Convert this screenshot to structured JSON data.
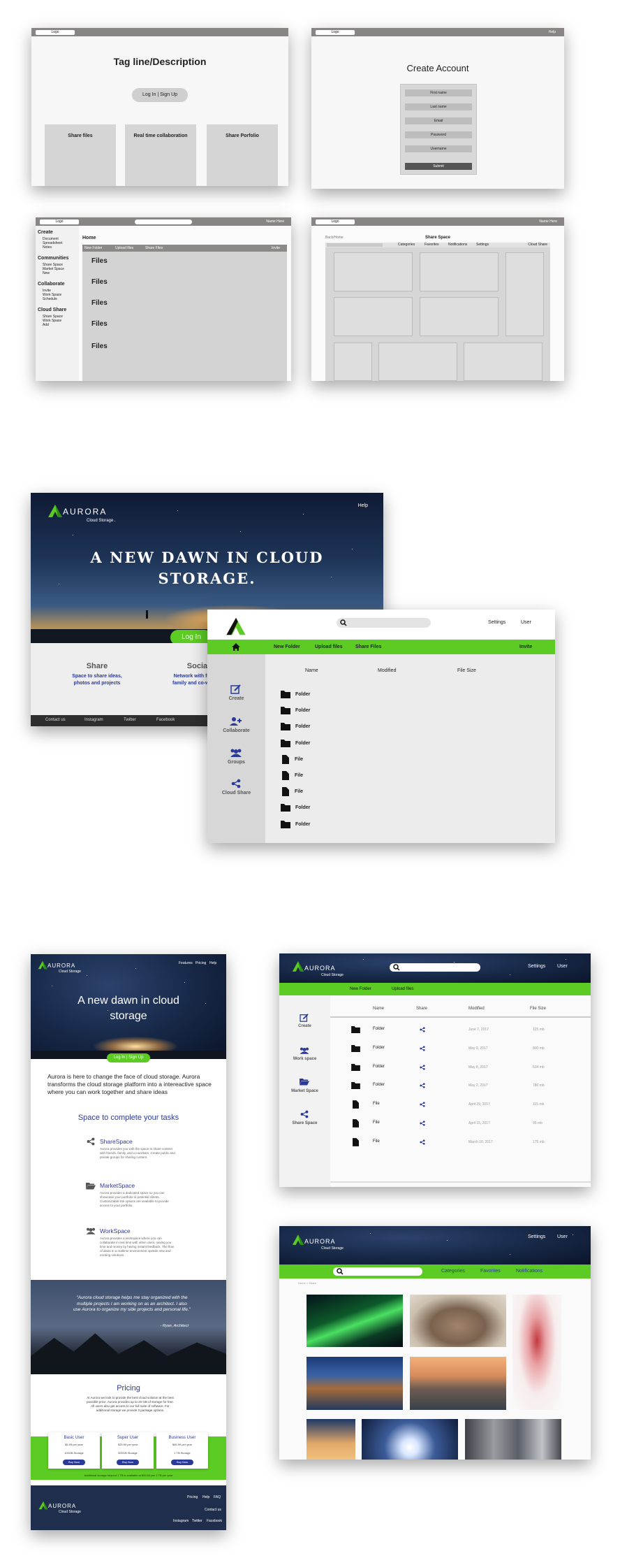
{
  "wireframes": {
    "landing": {
      "logo": "Logo",
      "tagline": "Tag line/Description",
      "login_button": "Log In | Sign Up",
      "features": [
        "Share files",
        "Real time collaboration",
        "Share Porfolio"
      ]
    },
    "create_account": {
      "logo": "Logo",
      "help": "Help",
      "title": "Create Account",
      "fields": [
        "First name",
        "Last name",
        "Email",
        "Password",
        "Username"
      ],
      "submit": "Submit"
    },
    "dashboard": {
      "logo": "Logo",
      "name_here": "Name Here",
      "sidebar": {
        "create": "Create",
        "create_items": [
          "Document",
          "Spreadsheet",
          "Notes"
        ],
        "communities": "Communities",
        "communities_items": [
          "Share Space",
          "Market Space",
          "New"
        ],
        "collaborate": "Collaborate",
        "collaborate_items": [
          "Invite",
          "Work Space",
          "Schedule"
        ],
        "cloud_share": "Cloud Share",
        "cloud_share_items": [
          "Share Space",
          "Work Space",
          "Add"
        ]
      },
      "home": "Home",
      "toolbar": [
        "New Folder",
        "Upload files",
        "Share Files"
      ],
      "invite": "Invite",
      "files": [
        "Files",
        "Files",
        "Files",
        "Files",
        "Files"
      ]
    },
    "share_space": {
      "logo": "Logo",
      "name_here": "Name Here",
      "back": "Back/Home",
      "title": "Share Space",
      "tabs": [
        "Categories",
        "Favorites",
        "Notifications",
        "Settings"
      ],
      "cloud_share": "Cloud Share"
    }
  },
  "mock_landing": {
    "brand": "AURORA",
    "brand_sub": "Cloud Storage",
    "help": "Help",
    "headline_line1": "A NEW DAWN IN CLOUD",
    "headline_line2": "STORAGE.",
    "login": "Log In",
    "cols": [
      {
        "title": "Share",
        "text_line1": "Space to share ideas,",
        "text_line2": "photos and projects"
      },
      {
        "title": "Social",
        "text_line1": "Network with friends,",
        "text_line2": "family and co-workers"
      }
    ],
    "footer": [
      "Contact us",
      "Instagram",
      "Twitter",
      "Facebook"
    ]
  },
  "mock_app": {
    "settings": "Settings",
    "user": "User",
    "toolbar": [
      "New Folder",
      "Upload files",
      "Share Files"
    ],
    "invite": "Invite",
    "sidebar": [
      "Create",
      "Collaborate",
      "Groups",
      "Cloud Share"
    ],
    "columns": [
      "Name",
      "Modified",
      "File Size"
    ],
    "rows": [
      "Folder",
      "Folder",
      "Folder",
      "Folder",
      "File",
      "File",
      "File",
      "Folder",
      "Folder"
    ]
  },
  "long_landing": {
    "brand": "AURORA",
    "brand_sub": "Cloud Storage",
    "nav": [
      "Features",
      "Pricing",
      "Help"
    ],
    "headline_line1": "A new dawn in cloud",
    "headline_line2": "storage",
    "login": "Log In | Sign Up",
    "intro": "Aurora is here to change the face of cloud storage. Aurora transforms the cloud storage platform into a intereactive space where you can work together and share ideas",
    "section_title": "Space to complete your tasks",
    "features": [
      {
        "title": "ShareSpace",
        "text": "Aurora provides you with the space to share content with friends, family, and co-workers. Create public and private groups for sharing content."
      },
      {
        "title": "MarketSpace",
        "text": "Aurora provides a dedicated space so you can showcase your portfolio to potential clients. Customizable link options are available to provide access to your portfolio."
      },
      {
        "title": "WorkSpace",
        "text": "Aurora provides a workspace where you can collaborate in real time with other users, saving you time and money by having instant feedback. The flow of ideas in a realtime environment speeds new and exciting solutions."
      }
    ],
    "quote": "\"Aurora cloud storage helps me stay organized with the multiple projects I am working on as an architect. I also use Aurora to organize my side projects and personal life.\"",
    "quote_author": "- Ryan, Architect",
    "pricing_title": "Pricing",
    "pricing_text": "At Aurora we look to provide the best cloud solution at the best possible price. Aurora provides up to 20 GB of storage for free. All users also get access to our full suite of software. For additional storage we provide 3 package options.",
    "plans": [
      {
        "name": "Basic User",
        "price": "$5.99 per year",
        "storage": "100GB Storage",
        "buy": "Buy Now"
      },
      {
        "name": "Super User",
        "price": "$25.99 per year",
        "storage": "500GB Storage",
        "buy": "Buy Now"
      },
      {
        "name": "Business User",
        "price": "$45.99 per year",
        "storage": "1 TB Storage",
        "buy": "Buy Now"
      }
    ],
    "additional": "Additional storage beyond 1 TB is available at $49.99 per 1 TB per year",
    "footer_links": [
      "Pricing",
      "Help",
      "FAQ"
    ],
    "contact": "Contact us",
    "social": [
      "Instagram",
      "Twitter",
      "Facebook"
    ]
  },
  "files_app": {
    "brand": "AURORA",
    "brand_sub": "Cloud Storage",
    "settings": "Settings",
    "user": "User",
    "toolbar": [
      "New Folder",
      "Upload files"
    ],
    "sidebar": [
      "Create",
      "Work space",
      "Market Space",
      "Share Space"
    ],
    "columns": [
      "Name",
      "Share",
      "Modified",
      "File Size"
    ],
    "rows": [
      {
        "name": "Folder",
        "modified": "June 7, 2017",
        "size": "125 mb"
      },
      {
        "name": "Folder",
        "modified": "May 9, 2017",
        "size": "800 mb"
      },
      {
        "name": "Folder",
        "modified": "May 8, 2017",
        "size": "634 mb"
      },
      {
        "name": "Folder",
        "modified": "May 2, 2017",
        "size": "780 mb"
      },
      {
        "name": "File",
        "modified": "April 29, 2017",
        "size": "115 mb"
      },
      {
        "name": "File",
        "modified": "April 15, 2017",
        "size": "95 mb"
      },
      {
        "name": "File",
        "modified": "March 10, 2017",
        "size": "175 mb"
      }
    ]
  },
  "gallery_app": {
    "brand": "AURORA",
    "brand_sub": "Cloud Storage",
    "settings": "Settings",
    "user": "User",
    "tabs": [
      "Categories",
      "Favorites",
      "Notifications"
    ],
    "breadcrumb": "Home > Share"
  }
}
